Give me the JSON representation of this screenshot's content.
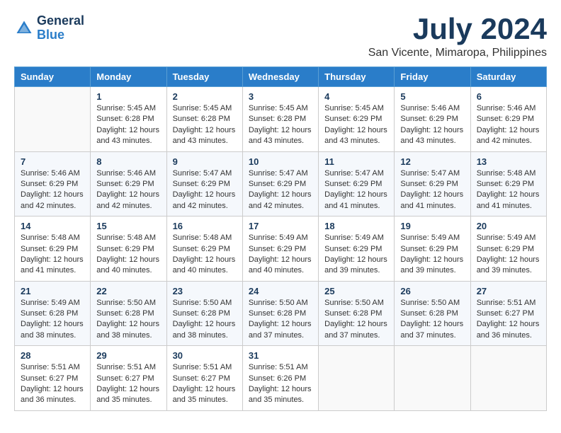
{
  "header": {
    "logo_general": "General",
    "logo_blue": "Blue",
    "title": "July 2024",
    "subtitle": "San Vicente, Mimaropa, Philippines"
  },
  "calendar": {
    "days_of_week": [
      "Sunday",
      "Monday",
      "Tuesday",
      "Wednesday",
      "Thursday",
      "Friday",
      "Saturday"
    ],
    "weeks": [
      [
        {
          "day": "",
          "detail": ""
        },
        {
          "day": "1",
          "detail": "Sunrise: 5:45 AM\nSunset: 6:28 PM\nDaylight: 12 hours\nand 43 minutes."
        },
        {
          "day": "2",
          "detail": "Sunrise: 5:45 AM\nSunset: 6:28 PM\nDaylight: 12 hours\nand 43 minutes."
        },
        {
          "day": "3",
          "detail": "Sunrise: 5:45 AM\nSunset: 6:28 PM\nDaylight: 12 hours\nand 43 minutes."
        },
        {
          "day": "4",
          "detail": "Sunrise: 5:45 AM\nSunset: 6:29 PM\nDaylight: 12 hours\nand 43 minutes."
        },
        {
          "day": "5",
          "detail": "Sunrise: 5:46 AM\nSunset: 6:29 PM\nDaylight: 12 hours\nand 43 minutes."
        },
        {
          "day": "6",
          "detail": "Sunrise: 5:46 AM\nSunset: 6:29 PM\nDaylight: 12 hours\nand 42 minutes."
        }
      ],
      [
        {
          "day": "7",
          "detail": "Sunrise: 5:46 AM\nSunset: 6:29 PM\nDaylight: 12 hours\nand 42 minutes."
        },
        {
          "day": "8",
          "detail": "Sunrise: 5:46 AM\nSunset: 6:29 PM\nDaylight: 12 hours\nand 42 minutes."
        },
        {
          "day": "9",
          "detail": "Sunrise: 5:47 AM\nSunset: 6:29 PM\nDaylight: 12 hours\nand 42 minutes."
        },
        {
          "day": "10",
          "detail": "Sunrise: 5:47 AM\nSunset: 6:29 PM\nDaylight: 12 hours\nand 42 minutes."
        },
        {
          "day": "11",
          "detail": "Sunrise: 5:47 AM\nSunset: 6:29 PM\nDaylight: 12 hours\nand 41 minutes."
        },
        {
          "day": "12",
          "detail": "Sunrise: 5:47 AM\nSunset: 6:29 PM\nDaylight: 12 hours\nand 41 minutes."
        },
        {
          "day": "13",
          "detail": "Sunrise: 5:48 AM\nSunset: 6:29 PM\nDaylight: 12 hours\nand 41 minutes."
        }
      ],
      [
        {
          "day": "14",
          "detail": "Sunrise: 5:48 AM\nSunset: 6:29 PM\nDaylight: 12 hours\nand 41 minutes."
        },
        {
          "day": "15",
          "detail": "Sunrise: 5:48 AM\nSunset: 6:29 PM\nDaylight: 12 hours\nand 40 minutes."
        },
        {
          "day": "16",
          "detail": "Sunrise: 5:48 AM\nSunset: 6:29 PM\nDaylight: 12 hours\nand 40 minutes."
        },
        {
          "day": "17",
          "detail": "Sunrise: 5:49 AM\nSunset: 6:29 PM\nDaylight: 12 hours\nand 40 minutes."
        },
        {
          "day": "18",
          "detail": "Sunrise: 5:49 AM\nSunset: 6:29 PM\nDaylight: 12 hours\nand 39 minutes."
        },
        {
          "day": "19",
          "detail": "Sunrise: 5:49 AM\nSunset: 6:29 PM\nDaylight: 12 hours\nand 39 minutes."
        },
        {
          "day": "20",
          "detail": "Sunrise: 5:49 AM\nSunset: 6:29 PM\nDaylight: 12 hours\nand 39 minutes."
        }
      ],
      [
        {
          "day": "21",
          "detail": "Sunrise: 5:49 AM\nSunset: 6:28 PM\nDaylight: 12 hours\nand 38 minutes."
        },
        {
          "day": "22",
          "detail": "Sunrise: 5:50 AM\nSunset: 6:28 PM\nDaylight: 12 hours\nand 38 minutes."
        },
        {
          "day": "23",
          "detail": "Sunrise: 5:50 AM\nSunset: 6:28 PM\nDaylight: 12 hours\nand 38 minutes."
        },
        {
          "day": "24",
          "detail": "Sunrise: 5:50 AM\nSunset: 6:28 PM\nDaylight: 12 hours\nand 37 minutes."
        },
        {
          "day": "25",
          "detail": "Sunrise: 5:50 AM\nSunset: 6:28 PM\nDaylight: 12 hours\nand 37 minutes."
        },
        {
          "day": "26",
          "detail": "Sunrise: 5:50 AM\nSunset: 6:28 PM\nDaylight: 12 hours\nand 37 minutes."
        },
        {
          "day": "27",
          "detail": "Sunrise: 5:51 AM\nSunset: 6:27 PM\nDaylight: 12 hours\nand 36 minutes."
        }
      ],
      [
        {
          "day": "28",
          "detail": "Sunrise: 5:51 AM\nSunset: 6:27 PM\nDaylight: 12 hours\nand 36 minutes."
        },
        {
          "day": "29",
          "detail": "Sunrise: 5:51 AM\nSunset: 6:27 PM\nDaylight: 12 hours\nand 35 minutes."
        },
        {
          "day": "30",
          "detail": "Sunrise: 5:51 AM\nSunset: 6:27 PM\nDaylight: 12 hours\nand 35 minutes."
        },
        {
          "day": "31",
          "detail": "Sunrise: 5:51 AM\nSunset: 6:26 PM\nDaylight: 12 hours\nand 35 minutes."
        },
        {
          "day": "",
          "detail": ""
        },
        {
          "day": "",
          "detail": ""
        },
        {
          "day": "",
          "detail": ""
        }
      ]
    ]
  }
}
